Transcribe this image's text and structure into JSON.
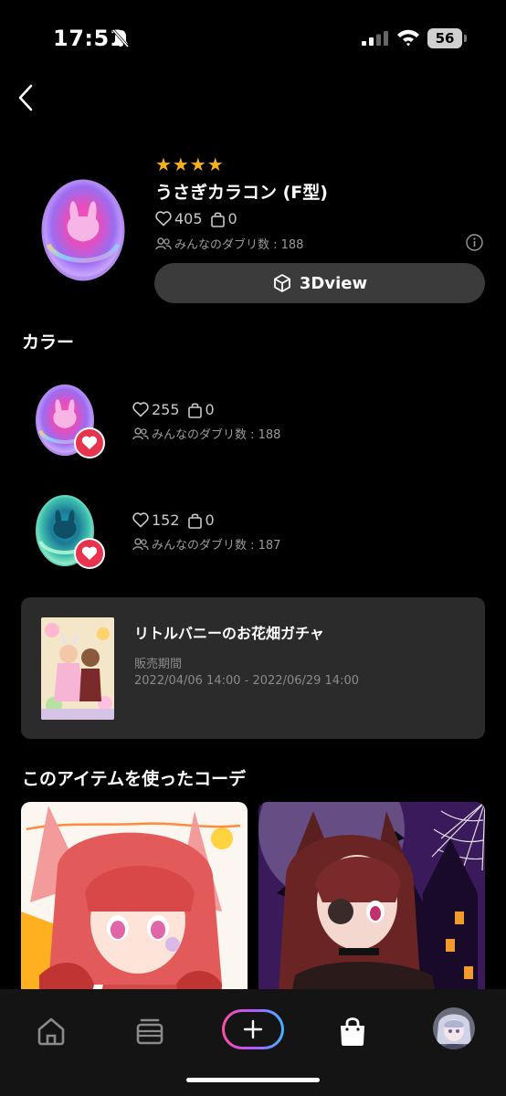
{
  "status_bar": {
    "time": "17:51",
    "battery": "56"
  },
  "item": {
    "stars": "★★★★",
    "title": "うさぎカラコン (F型)",
    "likes": "405",
    "bags": "0",
    "owners_text": "みんなのダブリ数 : 188",
    "view3d_label": "3Dview"
  },
  "colors_section": {
    "title": "カラー",
    "variants": [
      {
        "likes": "255",
        "bags": "0",
        "owners_text": "みんなのダブリ数 : 188"
      },
      {
        "likes": "152",
        "bags": "0",
        "owners_text": "みんなのダブリ数 : 187"
      }
    ]
  },
  "gacha": {
    "title": "リトルバニーのお花畑ガチャ",
    "period_label": "販売期間",
    "period": "2022/04/06 14:00 - 2022/06/29 14:00"
  },
  "coordinates_section": {
    "title": "このアイテムを使ったコーデ"
  },
  "tabbar": {
    "items": [
      "home-icon",
      "wallet-icon",
      "plus-icon",
      "shopping-bag-icon",
      "avatar"
    ]
  },
  "colors": {
    "star": "#f6b01d",
    "favorite": "#e8334f",
    "button_bg": "#3b3b3b",
    "card_bg": "#2b2b2b"
  }
}
